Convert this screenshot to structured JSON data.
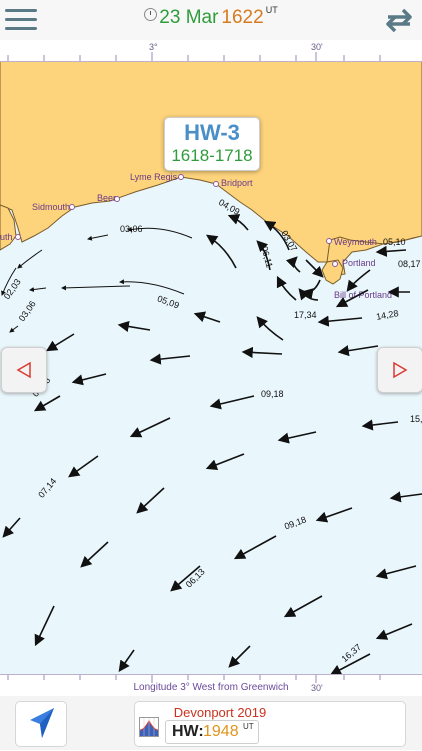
{
  "header": {
    "date": "23 Mar",
    "time": "1622",
    "time_zone": "UT",
    "icons": [
      "menu-icon",
      "clock-icon",
      "sync-icon"
    ]
  },
  "hw_panel": {
    "title": "HW-3",
    "range": "1618-1718"
  },
  "scale": {
    "top_ticks": [
      "3°",
      "30'"
    ],
    "bottom_label": "Longitude  3° West from Greenwich",
    "bottom_ticks": [
      "30'"
    ]
  },
  "places": [
    "Lyme Regis",
    "Bridport",
    "Beer",
    "Sidmouth",
    "Weymouth",
    "Portland",
    "Bill of Portland",
    "uth"
  ],
  "rates": [
    {
      "text": "03,06"
    },
    {
      "text": "04,09"
    },
    {
      "text": "03,07"
    },
    {
      "text": "06,11"
    },
    {
      "text": "05,10"
    },
    {
      "text": "08,17"
    },
    {
      "text": "02,03"
    },
    {
      "text": "03,06"
    },
    {
      "text": "05,09"
    },
    {
      "text": "17,34"
    },
    {
      "text": "14,28"
    },
    {
      "text": "04,08"
    },
    {
      "text": "09,18"
    },
    {
      "text": "15,"
    },
    {
      "text": "07,14"
    },
    {
      "text": "09,18"
    },
    {
      "text": "06,13"
    },
    {
      "text": "16,37"
    }
  ],
  "colors": {
    "land": "#fdd47c",
    "sea": "#e9f6fb",
    "arrow": "#111111",
    "title_green": "#2e9c3a",
    "title_orange": "#d77a1f",
    "hw_blue": "#4a8fc8",
    "port_red": "#c8321e"
  },
  "footer": {
    "port": "Devonport 2019",
    "hw_label": "HW:",
    "hw_time": "1948",
    "hw_zone": "UT",
    "icons": [
      "navigate-arrow-icon",
      "tide-graph-icon"
    ]
  },
  "nav": {
    "prev_icon": "triangle-left-icon",
    "next_icon": "triangle-right-icon"
  }
}
